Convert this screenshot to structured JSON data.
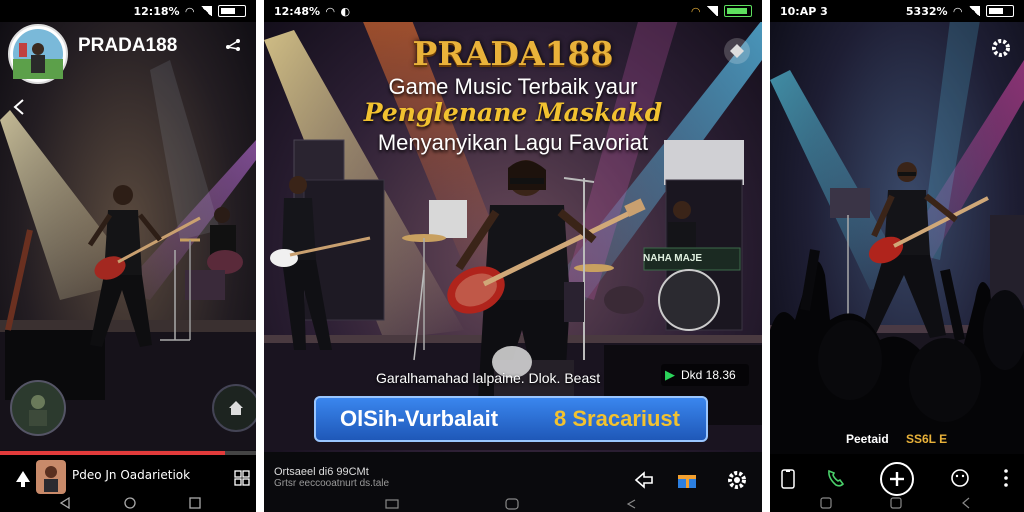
{
  "screen1": {
    "status_time": "12:18%",
    "channel_name": "PRADA188",
    "bottom_title": "Pdeo Jn Oadarietiok"
  },
  "screen2": {
    "status_left": "12:48%",
    "brand": "PRADA188",
    "headline_1": "Game Music Terbaik yaur",
    "headline_2": "Penglenane Maskakd",
    "headline_3": "Menyanyikan Lagu Favoriat",
    "caption": "Garalhamahad lalpaine. Dlok. Beast",
    "tag": "Dkd 18.36",
    "cta_left": "OlSih-Vurbalait",
    "cta_right": "8 Sracariust",
    "stage_sign": "NAHA MAJE",
    "footer_line1": "Ortsaeel di6 99CMt",
    "footer_line2": "Grtsr eeccooatnurt ds.tale"
  },
  "screen3": {
    "status_time": "10:AP 3",
    "status_right": "5332%",
    "caption_left": "Peetaid",
    "caption_right": "SS6L E"
  },
  "colors": {
    "gold": "#e9b23a",
    "cta_blue": "#2a6fd6",
    "cta_text": "#ffffff",
    "cta_accent": "#f2c230",
    "tag_green": "#2bd45a",
    "progress_red": "#e23b3b"
  }
}
